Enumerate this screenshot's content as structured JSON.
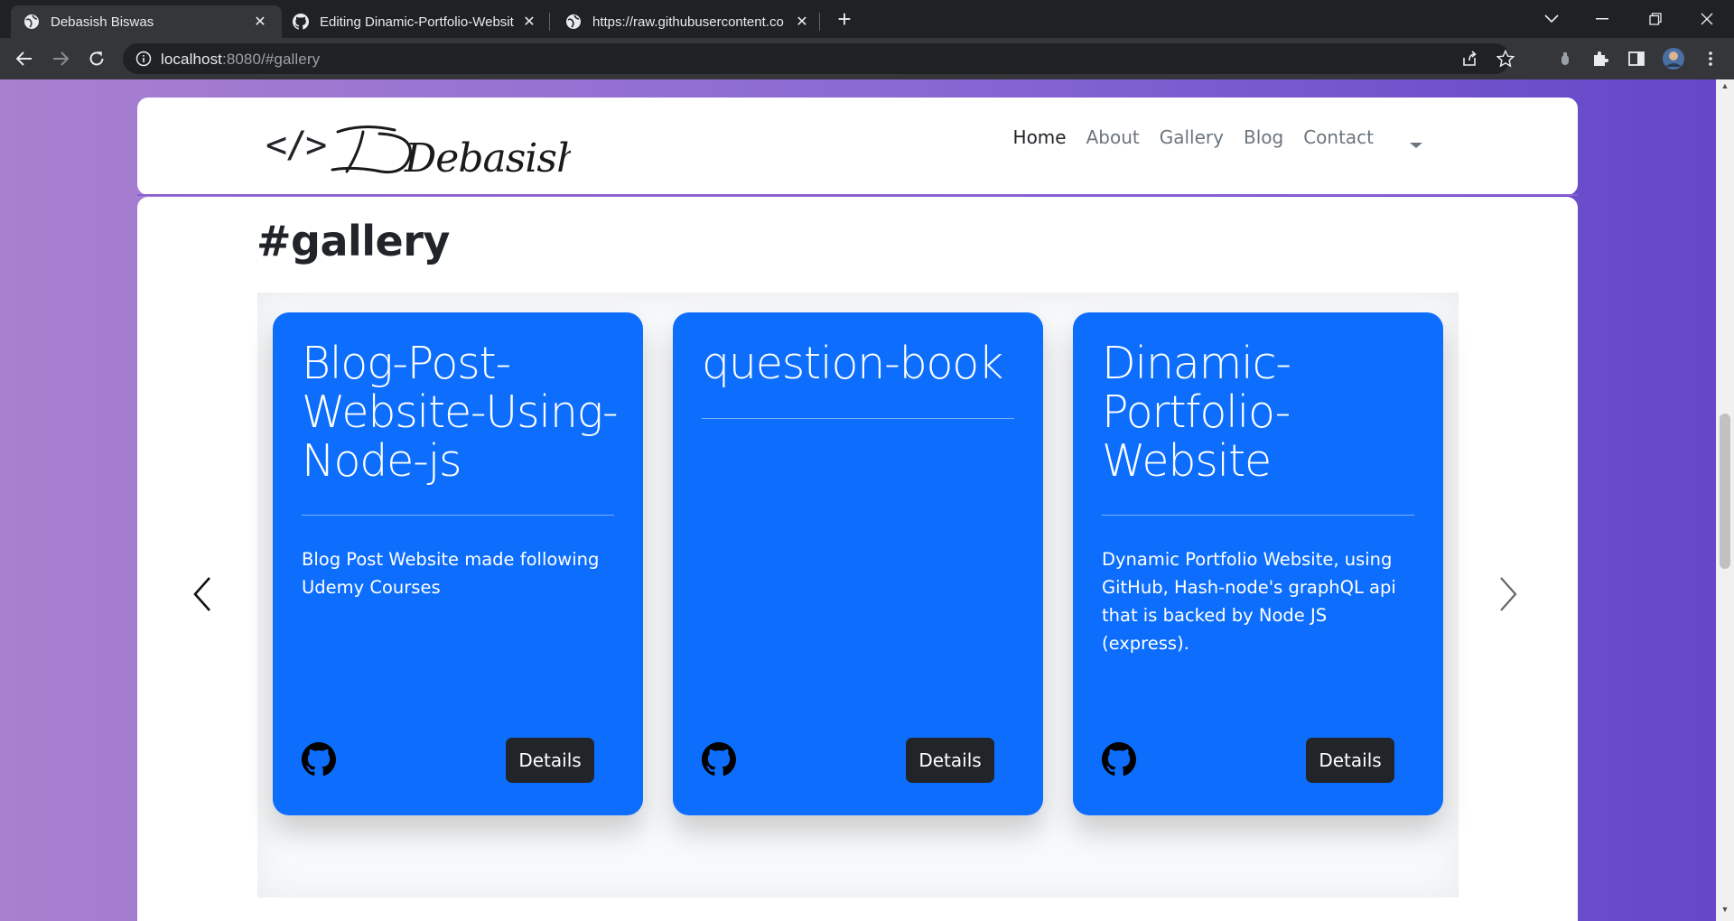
{
  "browser": {
    "tabs": [
      {
        "title": "Debasish Biswas",
        "active": true,
        "icon": "globe-icon"
      },
      {
        "title": "Editing Dinamic-Portfolio-Websit",
        "active": false,
        "icon": "github-icon"
      },
      {
        "title": "https://raw.githubusercontent.co",
        "active": false,
        "icon": "globe-icon"
      }
    ],
    "new_tab": "+",
    "url_host": "localhost",
    "url_rest": ":8080/#gallery"
  },
  "navbar": {
    "logo_code": "</>",
    "logo_name": "Debasish",
    "links": [
      "Home",
      "About",
      "Gallery",
      "Blog",
      "Contact"
    ],
    "active_link": "Home"
  },
  "gallery": {
    "title": "#gallery",
    "cards": [
      {
        "title": "Blog-Post-Website-Using-Node-js",
        "title_lines": [
          "Blog-Post-",
          "Website-Using-",
          "Node-js"
        ],
        "description": "Blog Post Website made following Udemy Courses",
        "button": "Details"
      },
      {
        "title": "question-book",
        "title_lines": [
          "question-book"
        ],
        "description": "",
        "button": "Details"
      },
      {
        "title": "Dinamic-Portfolio-Website",
        "title_lines": [
          "Dinamic-",
          "Portfolio-",
          "Website"
        ],
        "description": "Dynamic Portfolio Website, using GitHub, Hash-node's graphQL api that is backed by Node JS (express).",
        "button": "Details"
      }
    ]
  },
  "colors": {
    "card": "#0d6efd",
    "button": "#212529",
    "page_gradient": [
      "#a97fcf",
      "#6446c8"
    ]
  }
}
